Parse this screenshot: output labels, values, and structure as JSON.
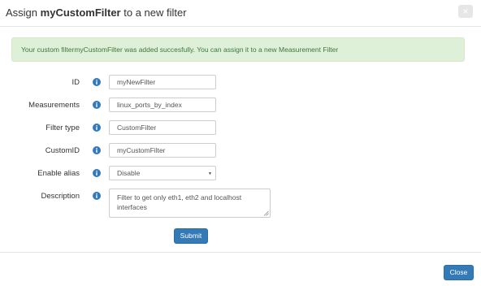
{
  "header": {
    "title_prefix": "Assign",
    "title_name": "myCustomFilter",
    "title_suffix": "to a new filter",
    "close_glyph": "×"
  },
  "alert": {
    "text": "Your custom filtermyCustomFilter was added succesfully. You can assign it to a new Measurement Filter",
    "color": "#3c763d",
    "background": "#dff0d8"
  },
  "form": {
    "id": {
      "label": "ID",
      "value": "myNewFilter"
    },
    "measurements": {
      "label": "Measurements",
      "value": "linux_ports_by_index"
    },
    "filter_type": {
      "label": "Filter type",
      "value": "CustomFilter"
    },
    "custom_id": {
      "label": "CustomID",
      "value": "myCustomFilter"
    },
    "enable_alias": {
      "label": "Enable alias",
      "selected": "Disable",
      "caret": "▼"
    },
    "description": {
      "label": "Description",
      "value": "Filter to get only eth1, eth2 and localhost interfaces"
    },
    "info_icon": "info-circle-icon",
    "info_color": "#337ab7"
  },
  "actions": {
    "submit_label": "Submit",
    "close_label": "Close",
    "primary_color": "#337ab7"
  }
}
